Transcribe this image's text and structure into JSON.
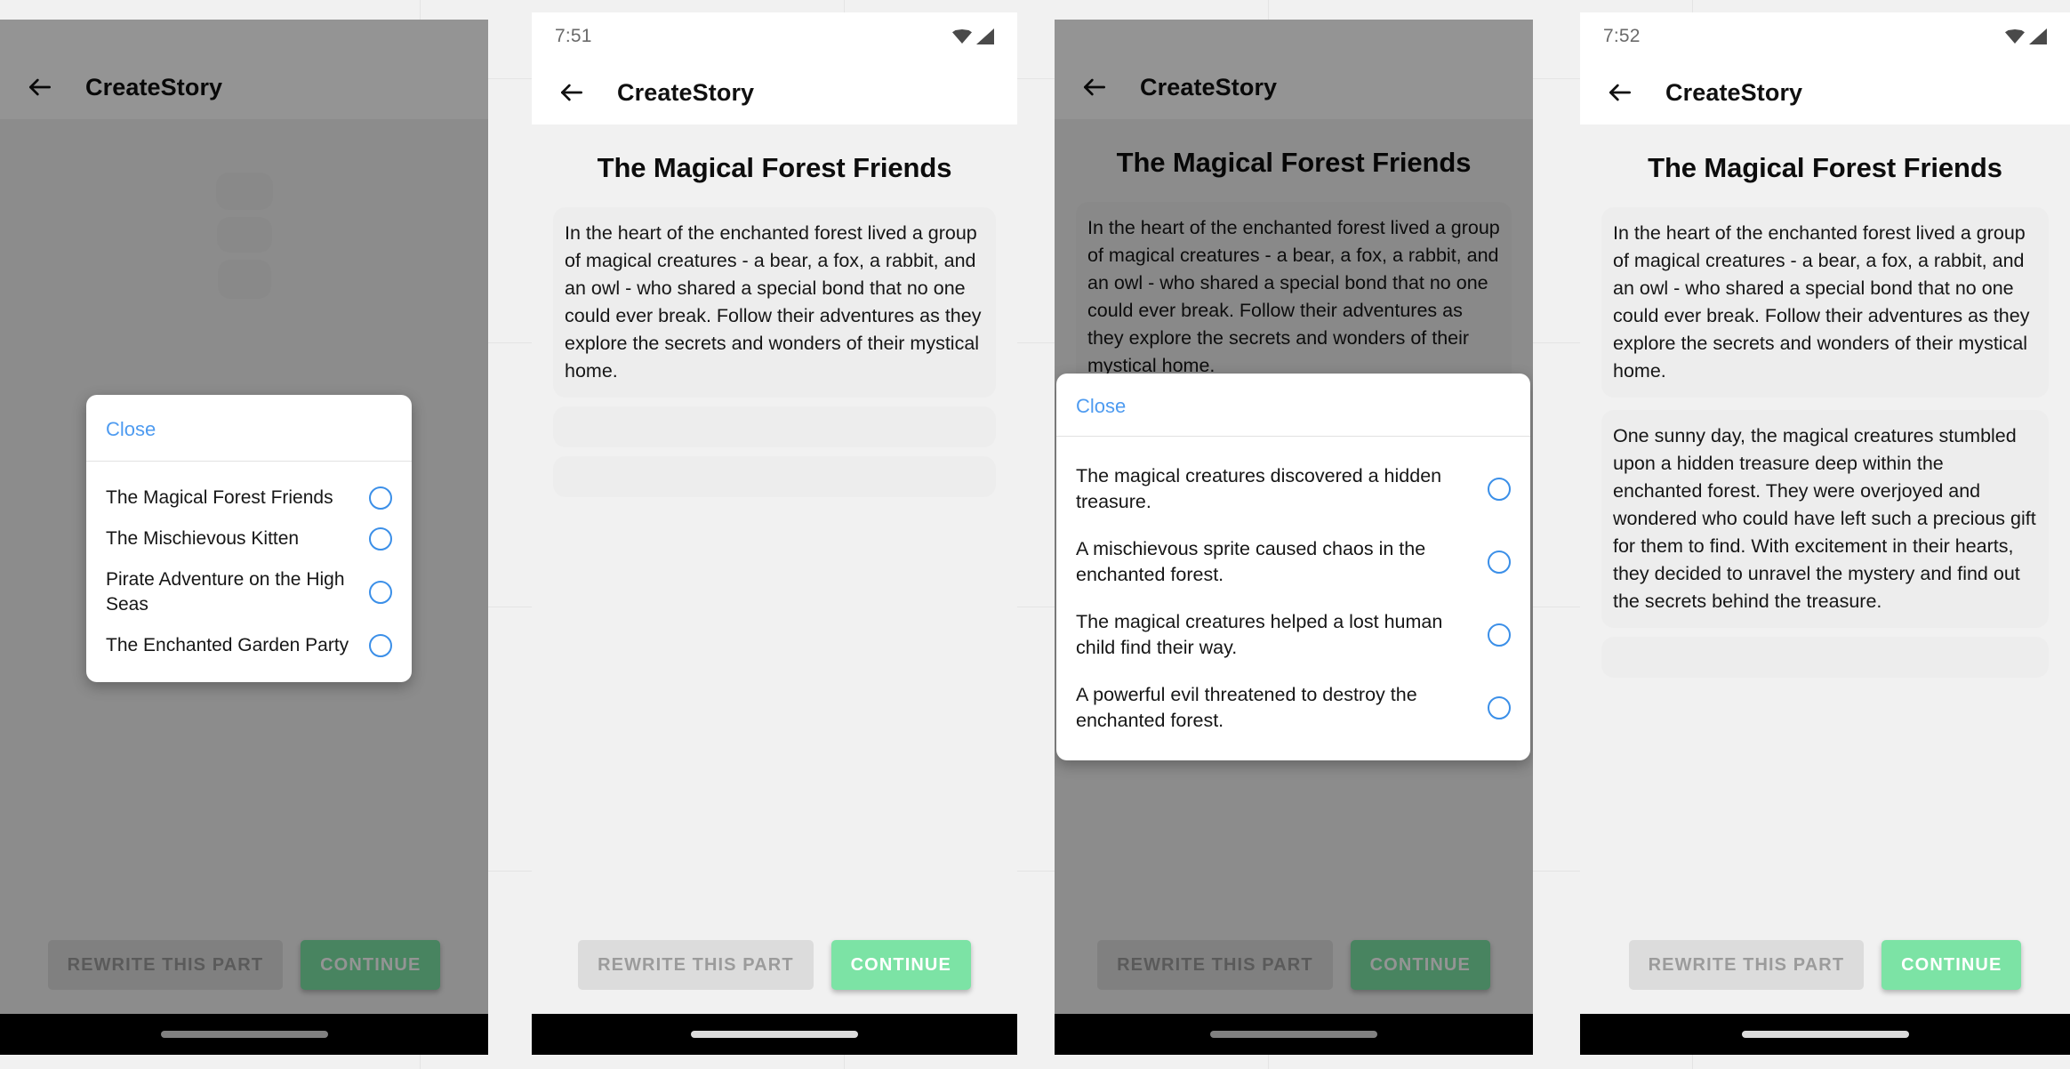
{
  "app": {
    "title": "CreateStory",
    "accent_blue": "#4e9bf0",
    "accent_green": "#7ce3a5",
    "radio_blue": "#3b8fe8",
    "scrim_color": "rgba(0,0,0,0.42)"
  },
  "icons": {
    "back": "back-arrow-icon",
    "wifi": "wifi-icon",
    "signal": "cellular-signal-icon",
    "home_indicator": "home-indicator-pill"
  },
  "story": {
    "title": "The Magical Forest Friends",
    "paragraph_1": "In the heart of the enchanted forest lived a group of magical creatures - a bear, a fox, a rabbit, and an owl - who shared a special bond that no one could ever break. Follow their adventures as they explore the secrets and wonders of their mystical home.",
    "paragraph_2": "One sunny day, the magical creatures stumbled upon a hidden treasure deep within the enchanted forest. They were overjoyed and wondered who could have left such a precious gift for them to find. With excitement in their hearts, they decided to unravel the mystery and find out the secrets behind the treasure."
  },
  "buttons": {
    "rewrite": "REWRITE THIS PART",
    "continue": "CONTINUE"
  },
  "dialog": {
    "close_label": "Close"
  },
  "panels": [
    {
      "id": "panel-1",
      "status_time": "",
      "status_visible": false,
      "dimmed": true,
      "shows_story": false,
      "dialog": {
        "kind": "story-title-picker",
        "options": [
          "The Magical Forest Friends",
          "The Mischievous Kitten",
          "Pirate Adventure on the High Seas",
          "The Enchanted Garden Party"
        ]
      }
    },
    {
      "id": "panel-2",
      "status_time": "7:51",
      "status_visible": true,
      "dimmed": false,
      "shows_story": true,
      "paragraph_count": 1,
      "dialog": null
    },
    {
      "id": "panel-3",
      "status_time": "",
      "status_visible": false,
      "dimmed": true,
      "shows_story": true,
      "paragraph_count": 1,
      "dialog": {
        "kind": "plot-continuation-picker",
        "options": [
          "The magical creatures discovered a hidden treasure.",
          "A mischievous sprite caused chaos in the enchanted forest.",
          "The magical creatures helped a lost human child find their way.",
          "A powerful evil threatened to destroy the enchanted forest."
        ]
      }
    },
    {
      "id": "panel-4",
      "status_time": "7:52",
      "status_visible": true,
      "dimmed": false,
      "shows_story": true,
      "paragraph_count": 2,
      "dialog": null
    }
  ]
}
